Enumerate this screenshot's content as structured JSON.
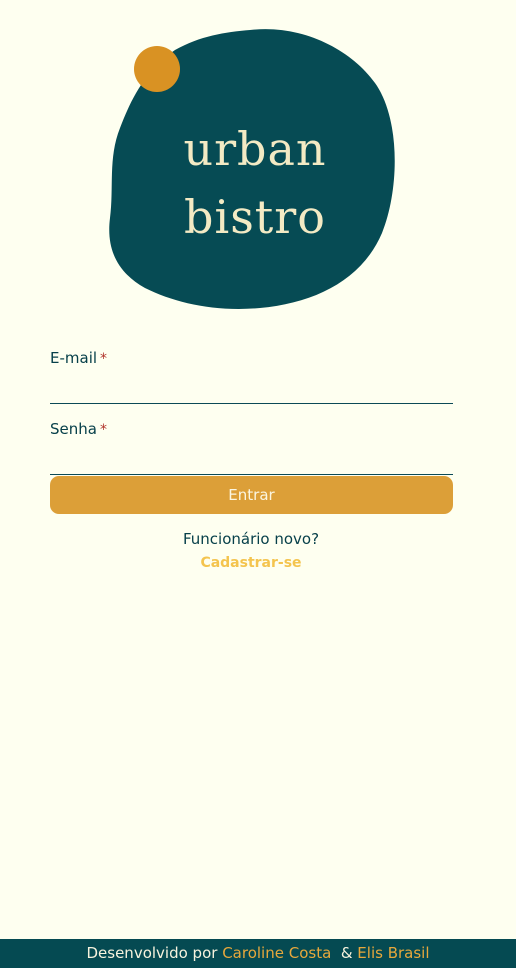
{
  "colors": {
    "background": "#fefff0",
    "brand_teal": "#064b54",
    "brand_gold": "#dc9f38",
    "required_marker": "#b1332a",
    "link": "#f4c44e"
  },
  "logo": {
    "line1": "urban",
    "line2": "bistro"
  },
  "form": {
    "email": {
      "label": "E-mail",
      "required_mark": "*",
      "value": "",
      "placeholder": ""
    },
    "password": {
      "label": "Senha",
      "required_mark": "*",
      "value": "",
      "placeholder": ""
    },
    "submit_label": "Entrar"
  },
  "signup": {
    "prompt": "Funcionário novo?",
    "link_label": "Cadastrar-se"
  },
  "footer": {
    "prefix": "Desenvolvido por",
    "author1": "Caroline Costa",
    "separator": "&",
    "author2": "Elis Brasil"
  }
}
